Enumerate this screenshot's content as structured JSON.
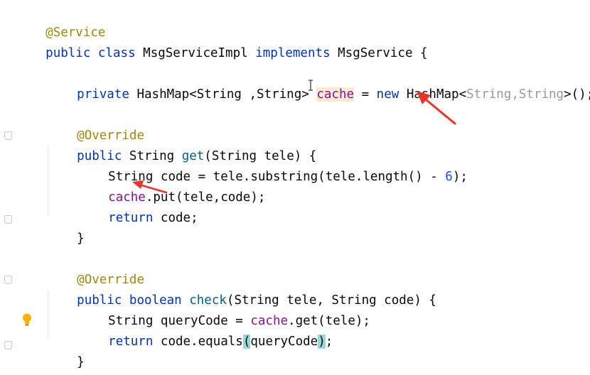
{
  "code": {
    "l1_annotation": "@Service",
    "l2_public": "public",
    "l2_class": "class",
    "l2_name": "MsgServiceImpl",
    "l2_implements": "implements",
    "l2_iface": "MsgService {",
    "l4_private": "private",
    "l4_type": "HashMap<String ,String>",
    "l4_field": "cache",
    "l4_eq": "=",
    "l4_new": "new",
    "l4_ctor": "HashMap<",
    "l4_generics": "String,String",
    "l4_end": ">();",
    "l6_annotation": "@Override",
    "l7_public": "public",
    "l7_type": "String",
    "l7_method": "get",
    "l7_params": "(String tele) {",
    "l8_text": "String code = tele.substring(tele.length() - ",
    "l8_num": "6",
    "l8_end": ");",
    "l9_field": "cache",
    "l9_call": ".put(tele,code);",
    "l10_return": "return",
    "l10_rest": "code;",
    "l11_brace": "}",
    "l13_annotation": "@Override",
    "l14_public": "public",
    "l14_type": "boolean",
    "l14_method": "check",
    "l14_params": "(String tele, String code) {",
    "l15_text": "String queryCode = ",
    "l15_field": "cache",
    "l15_call": ".get(tele);",
    "l16_return": "return",
    "l16_pre": "code.equals",
    "l16_open": "(",
    "l16_arg": "queryCode",
    "l16_close": ")",
    "l16_end": ";",
    "l17_brace": "}",
    "l18_brace": "}"
  },
  "colors": {
    "keyword": "#0033b3",
    "annotation": "#9e880d",
    "field": "#871094",
    "number": "#1750eb",
    "generic_param": "#9a9a9a",
    "method_decl": "#00627a",
    "annotation_arrow": "#e8352a"
  },
  "icons": {
    "intention": "lightbulb-icon",
    "fold": "fold-marker-icon",
    "cursor": "text-cursor-icon",
    "arrows": "red-arrow-icon"
  }
}
